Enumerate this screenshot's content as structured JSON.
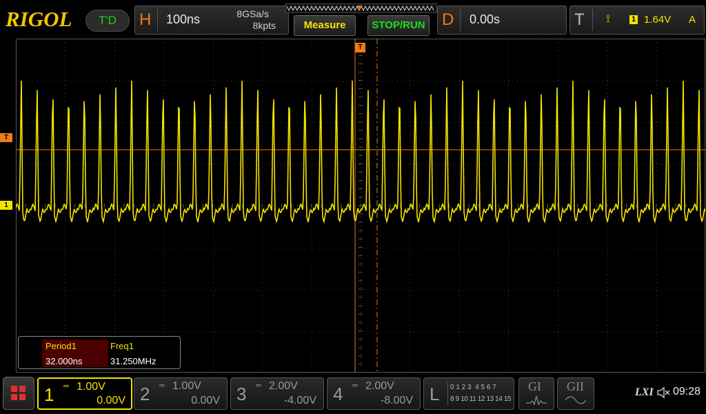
{
  "brand": {
    "logo": "RIGOL",
    "mode": "T'D"
  },
  "horizontal": {
    "label": "H",
    "timebase": "100ns",
    "sample_rate": "8GSa/s",
    "mem_depth": "8kpts"
  },
  "toolbar": {
    "measure_label": "Measure",
    "stop_run_label": "STOP/RUN"
  },
  "delay": {
    "label": "D",
    "value": "0.00s"
  },
  "trigger": {
    "label": "T",
    "channel": "1",
    "level": "1.64V",
    "mode": "A"
  },
  "markers": {
    "trigger_marker": "T",
    "channel1_marker": "1"
  },
  "measurements": {
    "headers": [
      "Period1",
      "Freq1"
    ],
    "values": [
      "32.000ns",
      "31.250MHz"
    ]
  },
  "channels": [
    {
      "num": "1",
      "scale": "1.00V",
      "offset": "0.00V",
      "active": true
    },
    {
      "num": "2",
      "scale": "1.00V",
      "offset": "0.00V",
      "active": false
    },
    {
      "num": "3",
      "scale": "2.00V",
      "offset": "-4.00V",
      "active": false
    },
    {
      "num": "4",
      "scale": "2.00V",
      "offset": "-8.00V",
      "active": false
    }
  ],
  "logic": {
    "label": "L",
    "row1": "0 1 2 3  4 5 6 7",
    "row2": "8 9 10 11 12 13 14 15"
  },
  "generators": {
    "g1": "GI",
    "g2": "GII"
  },
  "status": {
    "lxi": "LXI",
    "time": "09:28"
  },
  "colors": {
    "accent_orange": "#f07b16",
    "channel1_yellow": "#f4e300",
    "run_green": "#18e018"
  },
  "chart_data": {
    "type": "line",
    "title": "",
    "xlabel": "",
    "ylabel": "",
    "series": [
      {
        "name": "",
        "period_ns": 32.0,
        "frequency_mhz": 31.25
      }
    ]
  }
}
